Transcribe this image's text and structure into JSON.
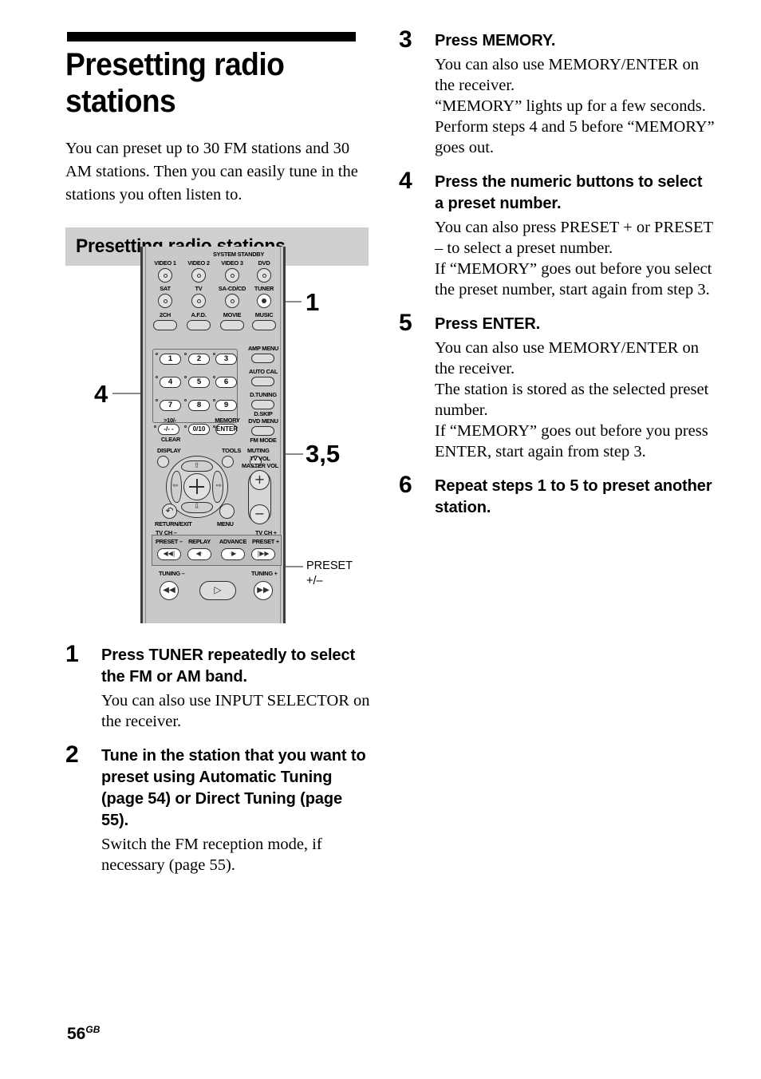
{
  "page": {
    "title": "Presetting radio stations",
    "intro": "You can preset up to 30 FM stations and 30 AM stations. Then you can easily tune in the stations you often listen to.",
    "section_heading": "Presetting radio stations",
    "footer_number": "56",
    "footer_suffix": "GB"
  },
  "figure": {
    "callouts": {
      "tuner": "1",
      "keypad": "4",
      "memory_enter": "3,5",
      "preset": "PRESET\n+/–"
    },
    "remote": {
      "system_standby_label": "SYSTEM STANDBY",
      "source_row_1": [
        "VIDEO 1",
        "VIDEO 2",
        "VIDEO 3",
        "DVD"
      ],
      "source_row_2": [
        "SAT",
        "TV",
        "SA-CD/CD",
        "TUNER"
      ],
      "sound_field_row": [
        "2CH",
        "A.F.D.",
        "MOVIE",
        "MUSIC"
      ],
      "numeric_keys": [
        "1",
        "2",
        "3",
        "4",
        "5",
        "6",
        "7",
        "8",
        "9"
      ],
      "key_clear_top": ">10/-",
      "key_clear_main": "-/- -",
      "key_clear_bottom": "CLEAR",
      "key_zero": "0/10",
      "key_memory_top": "MEMORY",
      "key_enter": "ENTER",
      "right_buttons": [
        "AMP MENU",
        "AUTO CAL",
        "D.TUNING",
        "D.SKIP",
        "DVD MENU",
        "FM MODE"
      ],
      "display_label": "DISPLAY",
      "tools_label": "TOOLS",
      "muting_label": "MUTING",
      "tv_vol_label": "TV VOL",
      "master_vol_label": "MASTER VOL",
      "vol_plus": "+",
      "vol_minus": "−",
      "return_label": "RETURN/EXIT",
      "menu_label": "MENU",
      "tv_ch_minus": "TV CH –",
      "tv_ch_plus": "TV CH +",
      "preset_minus": "PRESET –",
      "preset_plus": "PRESET +",
      "replay_label": "REPLAY",
      "advance_label": "ADVANCE",
      "tuning_minus": "TUNING –",
      "tuning_plus": "TUNING +",
      "glyph_prev": "◀◀|",
      "glyph_next": "|▶▶",
      "glyph_replay": "◀·",
      "glyph_advance": "·▶",
      "glyph_rew": "◀◀",
      "glyph_ff": "▶▶",
      "glyph_play": "▷",
      "glyph_return": "↶"
    }
  },
  "steps_left": [
    {
      "number": "1",
      "title": "Press TUNER repeatedly to select the FM or AM band.",
      "body": "You can also use INPUT SELECTOR on the receiver."
    },
    {
      "number": "2",
      "title": "Tune in the station that you want to preset using Automatic Tuning (page 54) or Direct Tuning (page 55).",
      "body": "Switch the FM reception mode, if necessary (page 55)."
    }
  ],
  "steps_right": [
    {
      "number": "3",
      "title": "Press MEMORY.",
      "body": "You can also use MEMORY/ENTER on the receiver.\n“MEMORY” lights up for a few seconds. Perform steps 4 and 5 before “MEMORY” goes out."
    },
    {
      "number": "4",
      "title": "Press the numeric buttons to select a preset number.",
      "body": "You can also press PRESET + or PRESET – to select a preset number.\nIf “MEMORY” goes out before you select the preset number, start again from step 3."
    },
    {
      "number": "5",
      "title": "Press ENTER.",
      "body": "You can also use MEMORY/ENTER on the receiver.\nThe station is stored as the selected preset number.\nIf “MEMORY” goes out before you press ENTER, start again from step 3."
    },
    {
      "number": "6",
      "title": "Repeat steps 1 to 5 to preset another station.",
      "body": ""
    }
  ]
}
